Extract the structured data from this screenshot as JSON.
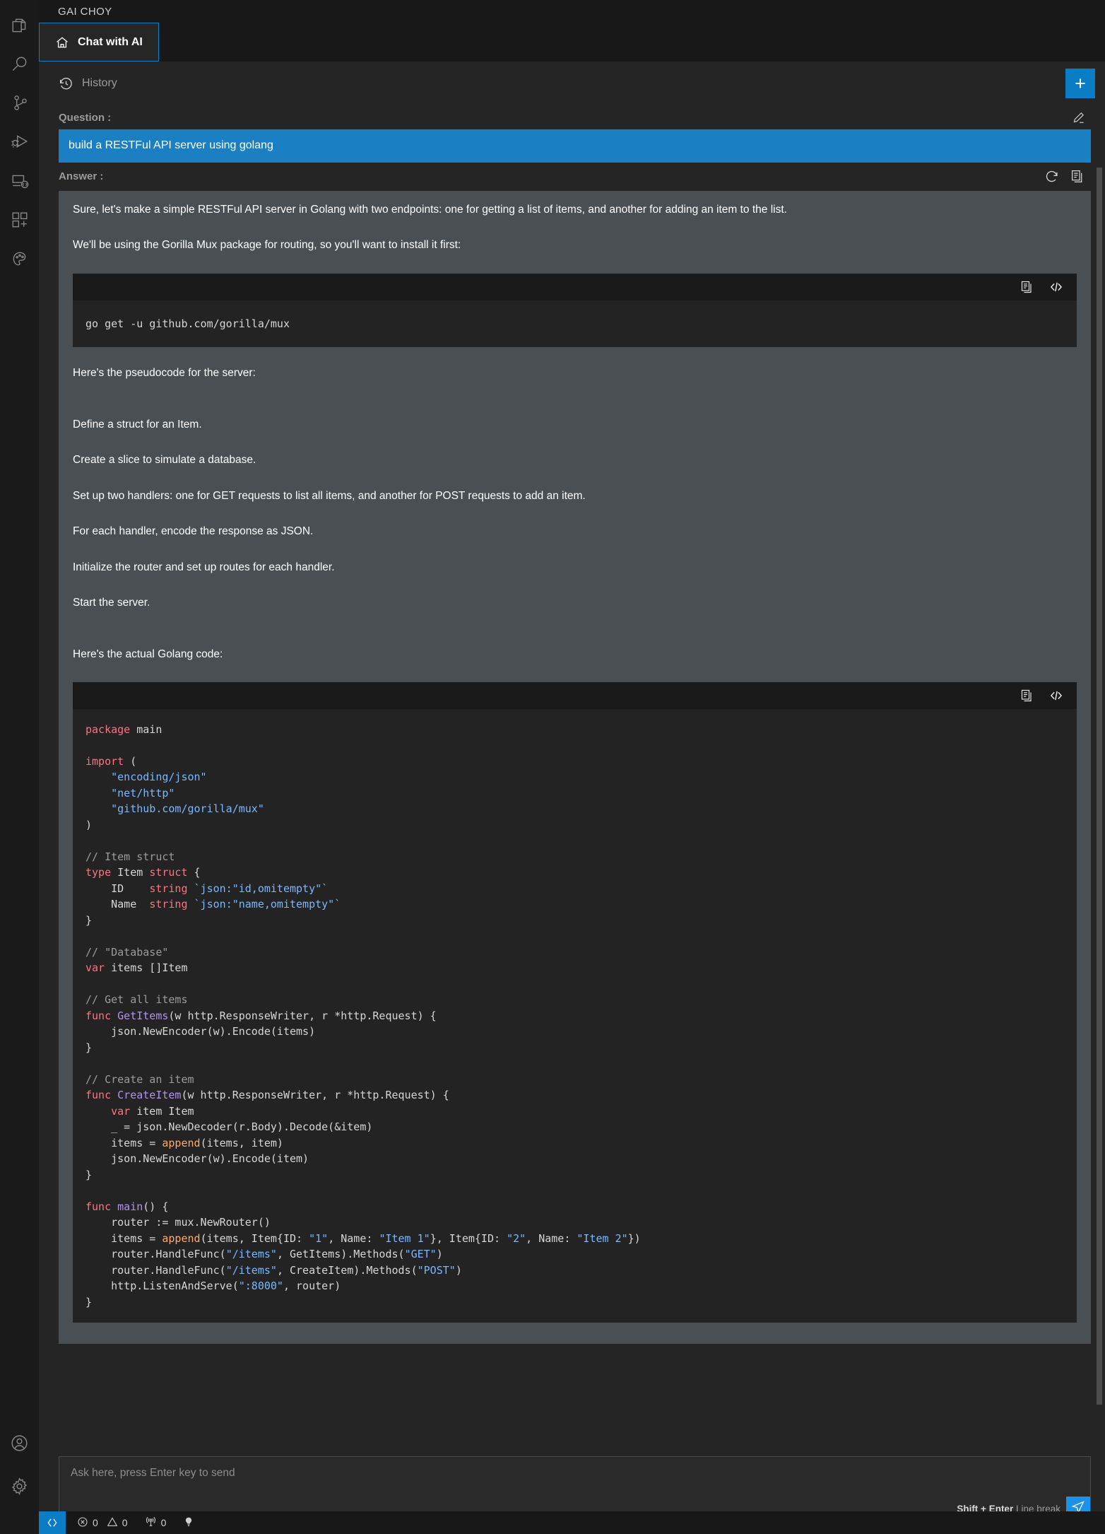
{
  "window": {
    "title": "GAI CHOY"
  },
  "activity_bar": {
    "items": [
      {
        "name": "explorer-icon",
        "label": "Explorer"
      },
      {
        "name": "search-icon",
        "label": "Search"
      },
      {
        "name": "source-control-icon",
        "label": "Source Control"
      },
      {
        "name": "run-and-debug-icon",
        "label": "Run and Debug"
      },
      {
        "name": "remote-explorer-icon",
        "label": "Remote Explorer"
      },
      {
        "name": "extensions-icon",
        "label": "Extensions"
      },
      {
        "name": "ai-assistant-icon",
        "label": "AI Assistant"
      }
    ],
    "bottom_items": [
      {
        "name": "account-icon",
        "label": "Accounts"
      },
      {
        "name": "settings-icon",
        "label": "Manage"
      }
    ]
  },
  "tab": {
    "label": "Chat with AI",
    "icon": "home-icon"
  },
  "toolbar": {
    "history_label": "History",
    "new_chat_label": "+"
  },
  "conversation": {
    "question_label": "Question :",
    "question_text": "build a RESTFul API server using golang",
    "edit_icon": "pencil-icon",
    "answer_label": "Answer :",
    "answer_actions": [
      "refresh-icon",
      "copy-icon"
    ],
    "paragraphs": [
      "Sure, let's make a simple RESTFul API server in Golang with two endpoints: one for getting a list of items, and another for adding an item to the list.",
      "We'll be using the Gorilla Mux package for routing, so you'll want to install it first:"
    ],
    "install_code": "go get -u github.com/gorilla/mux",
    "pseudocode_intro": "Here's the pseudocode for the server:",
    "pseudocode_steps": [
      "Define a struct for an Item.",
      "Create a slice to simulate a database.",
      "Set up two handlers: one for GET requests to list all items, and another for POST requests to add an item.",
      "For each handler, encode the response as JSON.",
      "Initialize the router and set up routes for each handler.",
      "Start the server."
    ],
    "code_intro": "Here's the actual Golang code:",
    "code_actions": [
      "copy-icon",
      "code-icon"
    ],
    "code_lines": [
      [
        [
          "kw",
          "package"
        ],
        [
          "pl",
          " main"
        ]
      ],
      [],
      [
        [
          "kw",
          "import"
        ],
        [
          "pl",
          " ("
        ]
      ],
      [
        [
          "pl",
          "    "
        ],
        [
          "str",
          "\"encoding/json\""
        ]
      ],
      [
        [
          "pl",
          "    "
        ],
        [
          "str",
          "\"net/http\""
        ]
      ],
      [
        [
          "pl",
          "    "
        ],
        [
          "str",
          "\"github.com/gorilla/mux\""
        ]
      ],
      [
        [
          "pl",
          ")"
        ]
      ],
      [],
      [
        [
          "cmt",
          "// Item struct"
        ]
      ],
      [
        [
          "kw",
          "type"
        ],
        [
          "pl",
          " Item "
        ],
        [
          "kw",
          "struct"
        ],
        [
          "pl",
          " {"
        ]
      ],
      [
        [
          "pl",
          "    ID    "
        ],
        [
          "kw",
          "string"
        ],
        [
          "pl",
          " "
        ],
        [
          "str",
          "`json:\"id,omitempty\"`"
        ]
      ],
      [
        [
          "pl",
          "    Name  "
        ],
        [
          "kw",
          "string"
        ],
        [
          "pl",
          " "
        ],
        [
          "str",
          "`json:\"name,omitempty\"`"
        ]
      ],
      [
        [
          "pl",
          "}"
        ]
      ],
      [],
      [
        [
          "cmt",
          "// \"Database\""
        ]
      ],
      [
        [
          "kw",
          "var"
        ],
        [
          "pl",
          " items []Item"
        ]
      ],
      [],
      [
        [
          "cmt",
          "// Get all items"
        ]
      ],
      [
        [
          "kw",
          "func"
        ],
        [
          "pl",
          " "
        ],
        [
          "fn",
          "GetItems"
        ],
        [
          "pl",
          "(w http.ResponseWriter, r *http.Request) {"
        ]
      ],
      [
        [
          "pl",
          "    json.NewEncoder(w).Encode(items)"
        ]
      ],
      [
        [
          "pl",
          "}"
        ]
      ],
      [],
      [
        [
          "cmt",
          "// Create an item"
        ]
      ],
      [
        [
          "kw",
          "func"
        ],
        [
          "pl",
          " "
        ],
        [
          "fn",
          "CreateItem"
        ],
        [
          "pl",
          "(w http.ResponseWriter, r *http.Request) {"
        ]
      ],
      [
        [
          "pl",
          "    "
        ],
        [
          "kw",
          "var"
        ],
        [
          "pl",
          " item Item"
        ]
      ],
      [
        [
          "pl",
          "    _ = json.NewDecoder(r.Body).Decode(&item)"
        ]
      ],
      [
        [
          "pl",
          "    items = "
        ],
        [
          "bi",
          "append"
        ],
        [
          "pl",
          "(items, item)"
        ]
      ],
      [
        [
          "pl",
          "    json.NewEncoder(w).Encode(item)"
        ]
      ],
      [
        [
          "pl",
          "}"
        ]
      ],
      [],
      [
        [
          "kw",
          "func"
        ],
        [
          "pl",
          " "
        ],
        [
          "fn",
          "main"
        ],
        [
          "pl",
          "() {"
        ]
      ],
      [
        [
          "pl",
          "    router := mux.NewRouter()"
        ]
      ],
      [
        [
          "pl",
          "    items = "
        ],
        [
          "bi",
          "append"
        ],
        [
          "pl",
          "(items, Item{ID: "
        ],
        [
          "str",
          "\"1\""
        ],
        [
          "pl",
          ", Name: "
        ],
        [
          "str",
          "\"Item 1\""
        ],
        [
          "pl",
          "}, Item{ID: "
        ],
        [
          "str",
          "\"2\""
        ],
        [
          "pl",
          ", Name: "
        ],
        [
          "str",
          "\"Item 2\""
        ],
        [
          "pl",
          "})"
        ]
      ],
      [
        [
          "pl",
          "    router.HandleFunc("
        ],
        [
          "str",
          "\"/items\""
        ],
        [
          "pl",
          ", GetItems).Methods("
        ],
        [
          "str",
          "\"GET\""
        ],
        [
          "pl",
          ")"
        ]
      ],
      [
        [
          "pl",
          "    router.HandleFunc("
        ],
        [
          "str",
          "\"/items\""
        ],
        [
          "pl",
          ", CreateItem).Methods("
        ],
        [
          "str",
          "\"POST\""
        ],
        [
          "pl",
          ")"
        ]
      ],
      [
        [
          "pl",
          "    http.ListenAndServe("
        ],
        [
          "str",
          "\":8000\""
        ],
        [
          "pl",
          ", router)"
        ]
      ],
      [
        [
          "pl",
          "}"
        ]
      ]
    ]
  },
  "composer": {
    "placeholder": "Ask here, press Enter key to send",
    "hint_bold": "Shift + Enter",
    "hint_rest": " Line break",
    "send_icon": "send-icon"
  },
  "statusbar": {
    "remote_icon": "remote-icon",
    "error_count": "0",
    "warning_count": "0",
    "ports_count": "0",
    "lightbulb_icon": "lightbulb-icon"
  },
  "colors": {
    "accent": "#0a7dc4",
    "question_bubble": "#1b7fc4",
    "answer_bg": "#4a4f53",
    "code_bg": "#232323",
    "panel_bg": "#252526"
  }
}
